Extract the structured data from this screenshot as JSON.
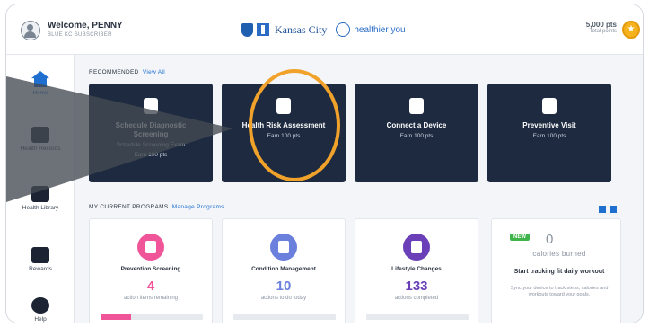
{
  "header": {
    "welcome": "Welcome, PENNY",
    "welcome_sub": "BLUE KC SUBSCRIBER",
    "brand_name": "Kansas City",
    "partner_logo_text": "healthier you",
    "points_value": "5,000 pts",
    "points_label": "Total points",
    "coin_icon": "star-icon"
  },
  "sidebar": {
    "items": [
      {
        "label": "Home",
        "icon": "home-icon",
        "active": true
      },
      {
        "label": "Health Records",
        "icon": "clipboard-icon",
        "active": false
      },
      {
        "label": "Health Library",
        "icon": "book-icon",
        "active": false
      },
      {
        "label": "Rewards",
        "icon": "inbox-icon",
        "active": false
      },
      {
        "label": "Help",
        "icon": "info-icon",
        "active": false
      }
    ]
  },
  "recommended": {
    "title": "RECOMMENDED",
    "link": "View All",
    "cards": [
      {
        "title": "Schedule Diagnostic Screening",
        "sub": "Schedule Screening Exam",
        "sub2": "Earn 100 pts",
        "icon": "stethoscope-icon"
      },
      {
        "title": "Health Risk Assessment",
        "sub": "Earn 100 pts",
        "icon": "clipboard-icon"
      },
      {
        "title": "Connect a Device",
        "sub": "Earn 100 pts",
        "icon": "watch-icon"
      },
      {
        "title": "Preventive Visit",
        "sub": "Earn 100 pts",
        "icon": "checklist-icon"
      }
    ]
  },
  "programs": {
    "title": "MY CURRENT PROGRAMS",
    "link": "Manage Programs",
    "cards": [
      {
        "title": "Prevention Screening",
        "value": "4",
        "sub": "action items remaining",
        "color": "#f0559a",
        "progress": 0.3
      },
      {
        "title": "Condition Management",
        "value": "10",
        "sub": "actions to do today",
        "color": "#6b7fdc",
        "progress": 0
      },
      {
        "title": "Lifestyle Changes",
        "value": "133",
        "sub": "actions completed",
        "color": "#6a3fb8",
        "progress": 0
      }
    ],
    "calories": {
      "badge": "NEW",
      "value": "0",
      "label": "calories burned",
      "headline": "Start tracking fit daily workout",
      "desc": "Sync your device to track steps, calories and workouts toward your goals."
    }
  },
  "colors": {
    "dark_card": "#1e2a40",
    "accent": "#1f6fd1",
    "highlight": "#f0a22a"
  }
}
